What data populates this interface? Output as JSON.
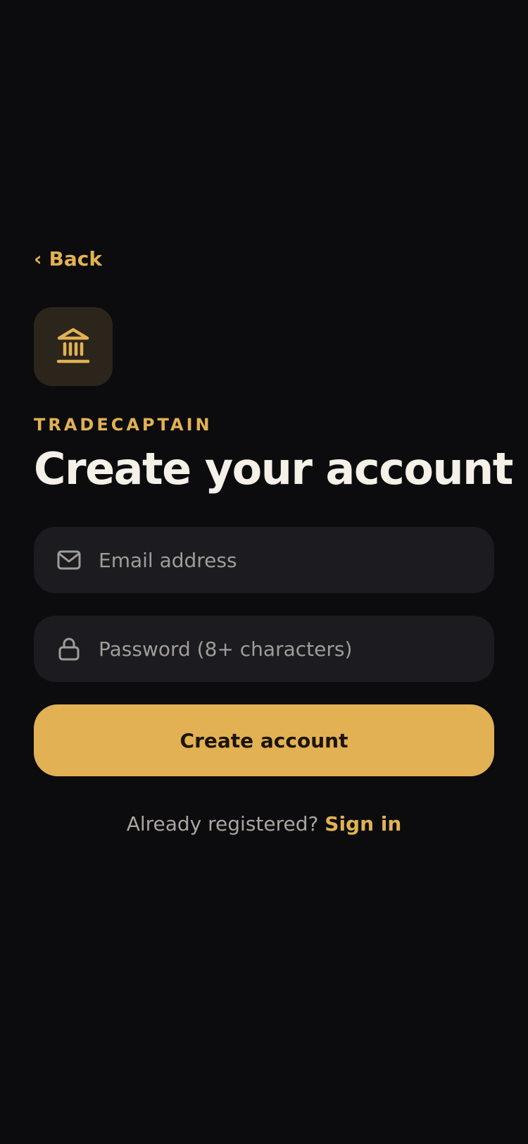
{
  "nav": {
    "back_chevron": "‹",
    "back_label": "Back"
  },
  "brand": {
    "icon": "bank-icon",
    "name": "TRADECAPTAIN"
  },
  "page": {
    "title": "Create your account"
  },
  "form": {
    "email": {
      "icon": "mail-icon",
      "placeholder": "Email address",
      "value": ""
    },
    "password": {
      "icon": "lock-icon",
      "placeholder": "Password (8+ characters)",
      "value": ""
    },
    "submit_label": "Create account"
  },
  "footer": {
    "prompt": "Already registered?",
    "signin_label": "Sign in"
  },
  "colors": {
    "background": "#0c0c0e",
    "accent": "#e1b154",
    "field_bg": "#1b1b20",
    "logo_tile_bg": "#2b251c",
    "title_text": "#f5f0e8",
    "muted_text": "#a09d98"
  }
}
